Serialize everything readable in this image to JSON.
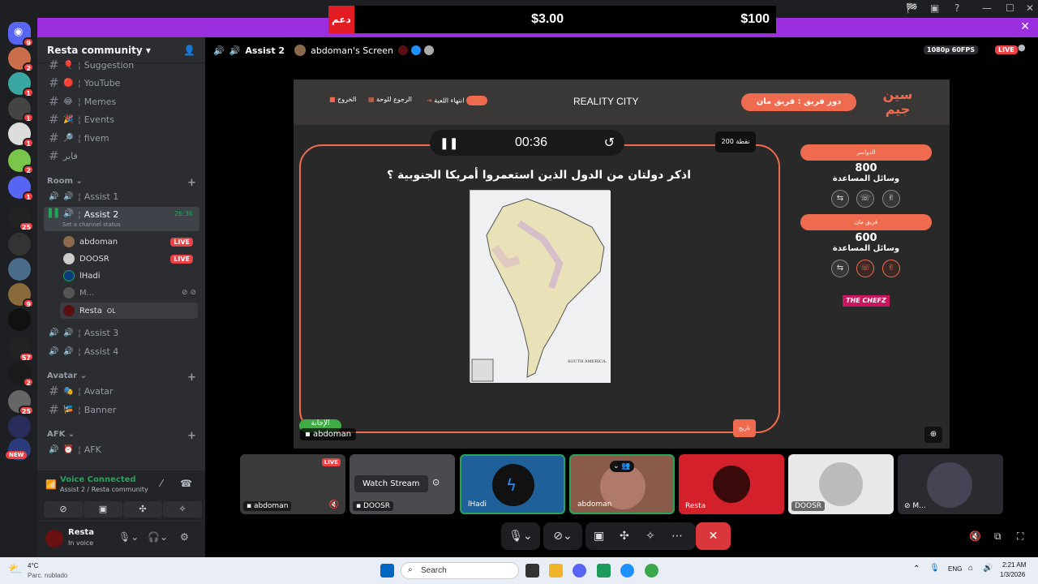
{
  "window": {
    "controls": [
      "🏁",
      "▣",
      "?",
      "—",
      "☐",
      "✕"
    ]
  },
  "promo": {
    "tag": "دعم",
    "price1": "$3.00",
    "price2": "$100",
    "close": "✕"
  },
  "servers": {
    "badges": [
      "9",
      "2",
      "1",
      "1",
      "1",
      "2",
      "1",
      "25",
      "9",
      "57",
      "2",
      "25"
    ],
    "new_label": "NEW"
  },
  "guild": {
    "name": "Resta community ▾"
  },
  "channels": {
    "text": [
      {
        "label": "Suggestion",
        "emoji": "🎈"
      },
      {
        "label": "YouTube",
        "emoji": "🔴"
      },
      {
        "label": "Memes",
        "emoji": "😂"
      },
      {
        "label": "Events",
        "emoji": "🎉"
      },
      {
        "label": "fivem",
        "emoji": "🔎"
      },
      {
        "label": "فاير",
        "emoji": ""
      }
    ],
    "room_category": "Room ⌄",
    "voice": [
      {
        "label": "Assist 1"
      },
      {
        "label": "Assist 2",
        "time": "26:36",
        "status": "Set a channel status"
      },
      {
        "label": "Assist 3"
      },
      {
        "label": "Assist 4"
      }
    ],
    "voice_users": [
      {
        "name": "abdoman",
        "live": "LIVE"
      },
      {
        "name": "DOOSR",
        "live": "LIVE"
      },
      {
        "name": "lHadi",
        "live": ""
      },
      {
        "name": "M...",
        "live": ""
      },
      {
        "name": "Resta",
        "extra": "OL"
      }
    ],
    "avatar_category": "Avatar ⌄",
    "avatar_channels": [
      {
        "label": "Avatar",
        "emoji": "🎭"
      },
      {
        "label": "Banner",
        "emoji": "🎏"
      }
    ],
    "afk_category": "AFK ⌄",
    "afk_channels": [
      {
        "label": "AFK",
        "emoji": "⏰"
      }
    ]
  },
  "voice_connected": {
    "title": "Voice Connected",
    "sub": "Assist 2 / Resta community"
  },
  "user": {
    "name": "Resta",
    "status": "In voice"
  },
  "stage": {
    "channel": "Assist 2",
    "screen": "abdoman's Screen",
    "quality": "1080p 60FPS",
    "live": "LIVE"
  },
  "game": {
    "title": "REALITY CITY",
    "turn": "دور فريق : فريق مان",
    "exit": "الخروج",
    "back": "الرجوع للوحة",
    "end": "انتهاء اللعبة",
    "timer": "00:36",
    "question": "اذكر دولتان من الدول الذين استعمروا أمريكا الجنوبية ؟",
    "points": "200 نقطة",
    "teams": [
      {
        "name": "الدواسر",
        "score": "800",
        "helps": "وسائل المساعدة"
      },
      {
        "name": "فريق مان",
        "score": "600",
        "helps": "وسائل المساعدة"
      }
    ],
    "sponsor": "THE CHEFZ",
    "answer_btn": "الإجابة",
    "history_btn": "تاريخ",
    "map_caption": "SOUTH AMERICA.",
    "streamer_label": "abdoman"
  },
  "tiles": [
    {
      "name": "abdoman",
      "live": "LIVE"
    },
    {
      "name": "DOOSR",
      "watch": "Watch Stream"
    },
    {
      "name": "lHadi"
    },
    {
      "name": "abdoman"
    },
    {
      "name": "Resta"
    },
    {
      "name": "DOOSR"
    },
    {
      "name": "M..."
    }
  ],
  "taskbar": {
    "temp": "4°C",
    "weather": "Parc. nublado",
    "search": "Search",
    "lang": "ENG",
    "time": "2:21 AM",
    "date": "1/3/2026"
  },
  "colors": {
    "accent": "#ef6b4f",
    "promo": "#9b2fe0",
    "live": "#ed4245",
    "green": "#23a55a"
  }
}
